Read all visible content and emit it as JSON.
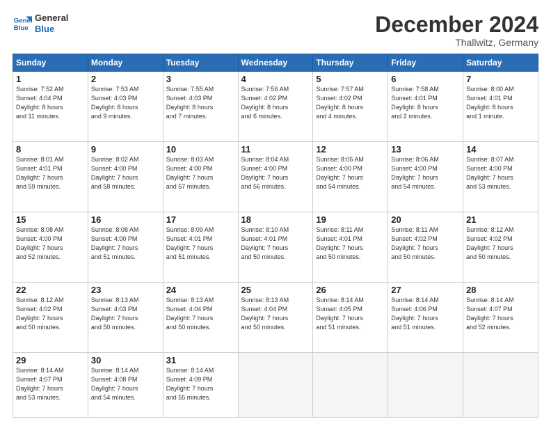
{
  "logo": {
    "line1": "General",
    "line2": "Blue"
  },
  "title": "December 2024",
  "subtitle": "Thallwitz, Germany",
  "weekdays": [
    "Sunday",
    "Monday",
    "Tuesday",
    "Wednesday",
    "Thursday",
    "Friday",
    "Saturday"
  ],
  "weeks": [
    [
      {
        "day": "1",
        "info": "Sunrise: 7:52 AM\nSunset: 4:04 PM\nDaylight: 8 hours\nand 11 minutes."
      },
      {
        "day": "2",
        "info": "Sunrise: 7:53 AM\nSunset: 4:03 PM\nDaylight: 8 hours\nand 9 minutes."
      },
      {
        "day": "3",
        "info": "Sunrise: 7:55 AM\nSunset: 4:03 PM\nDaylight: 8 hours\nand 7 minutes."
      },
      {
        "day": "4",
        "info": "Sunrise: 7:56 AM\nSunset: 4:02 PM\nDaylight: 8 hours\nand 6 minutes."
      },
      {
        "day": "5",
        "info": "Sunrise: 7:57 AM\nSunset: 4:02 PM\nDaylight: 8 hours\nand 4 minutes."
      },
      {
        "day": "6",
        "info": "Sunrise: 7:58 AM\nSunset: 4:01 PM\nDaylight: 8 hours\nand 2 minutes."
      },
      {
        "day": "7",
        "info": "Sunrise: 8:00 AM\nSunset: 4:01 PM\nDaylight: 8 hours\nand 1 minute."
      }
    ],
    [
      {
        "day": "8",
        "info": "Sunrise: 8:01 AM\nSunset: 4:01 PM\nDaylight: 7 hours\nand 59 minutes."
      },
      {
        "day": "9",
        "info": "Sunrise: 8:02 AM\nSunset: 4:00 PM\nDaylight: 7 hours\nand 58 minutes."
      },
      {
        "day": "10",
        "info": "Sunrise: 8:03 AM\nSunset: 4:00 PM\nDaylight: 7 hours\nand 57 minutes."
      },
      {
        "day": "11",
        "info": "Sunrise: 8:04 AM\nSunset: 4:00 PM\nDaylight: 7 hours\nand 56 minutes."
      },
      {
        "day": "12",
        "info": "Sunrise: 8:05 AM\nSunset: 4:00 PM\nDaylight: 7 hours\nand 54 minutes."
      },
      {
        "day": "13",
        "info": "Sunrise: 8:06 AM\nSunset: 4:00 PM\nDaylight: 7 hours\nand 54 minutes."
      },
      {
        "day": "14",
        "info": "Sunrise: 8:07 AM\nSunset: 4:00 PM\nDaylight: 7 hours\nand 53 minutes."
      }
    ],
    [
      {
        "day": "15",
        "info": "Sunrise: 8:08 AM\nSunset: 4:00 PM\nDaylight: 7 hours\nand 52 minutes."
      },
      {
        "day": "16",
        "info": "Sunrise: 8:08 AM\nSunset: 4:00 PM\nDaylight: 7 hours\nand 51 minutes."
      },
      {
        "day": "17",
        "info": "Sunrise: 8:09 AM\nSunset: 4:01 PM\nDaylight: 7 hours\nand 51 minutes."
      },
      {
        "day": "18",
        "info": "Sunrise: 8:10 AM\nSunset: 4:01 PM\nDaylight: 7 hours\nand 50 minutes."
      },
      {
        "day": "19",
        "info": "Sunrise: 8:11 AM\nSunset: 4:01 PM\nDaylight: 7 hours\nand 50 minutes."
      },
      {
        "day": "20",
        "info": "Sunrise: 8:11 AM\nSunset: 4:02 PM\nDaylight: 7 hours\nand 50 minutes."
      },
      {
        "day": "21",
        "info": "Sunrise: 8:12 AM\nSunset: 4:02 PM\nDaylight: 7 hours\nand 50 minutes."
      }
    ],
    [
      {
        "day": "22",
        "info": "Sunrise: 8:12 AM\nSunset: 4:02 PM\nDaylight: 7 hours\nand 50 minutes."
      },
      {
        "day": "23",
        "info": "Sunrise: 8:13 AM\nSunset: 4:03 PM\nDaylight: 7 hours\nand 50 minutes."
      },
      {
        "day": "24",
        "info": "Sunrise: 8:13 AM\nSunset: 4:04 PM\nDaylight: 7 hours\nand 50 minutes."
      },
      {
        "day": "25",
        "info": "Sunrise: 8:13 AM\nSunset: 4:04 PM\nDaylight: 7 hours\nand 50 minutes."
      },
      {
        "day": "26",
        "info": "Sunrise: 8:14 AM\nSunset: 4:05 PM\nDaylight: 7 hours\nand 51 minutes."
      },
      {
        "day": "27",
        "info": "Sunrise: 8:14 AM\nSunset: 4:06 PM\nDaylight: 7 hours\nand 51 minutes."
      },
      {
        "day": "28",
        "info": "Sunrise: 8:14 AM\nSunset: 4:07 PM\nDaylight: 7 hours\nand 52 minutes."
      }
    ],
    [
      {
        "day": "29",
        "info": "Sunrise: 8:14 AM\nSunset: 4:07 PM\nDaylight: 7 hours\nand 53 minutes."
      },
      {
        "day": "30",
        "info": "Sunrise: 8:14 AM\nSunset: 4:08 PM\nDaylight: 7 hours\nand 54 minutes."
      },
      {
        "day": "31",
        "info": "Sunrise: 8:14 AM\nSunset: 4:09 PM\nDaylight: 7 hours\nand 55 minutes."
      },
      {
        "day": "",
        "info": ""
      },
      {
        "day": "",
        "info": ""
      },
      {
        "day": "",
        "info": ""
      },
      {
        "day": "",
        "info": ""
      }
    ]
  ]
}
